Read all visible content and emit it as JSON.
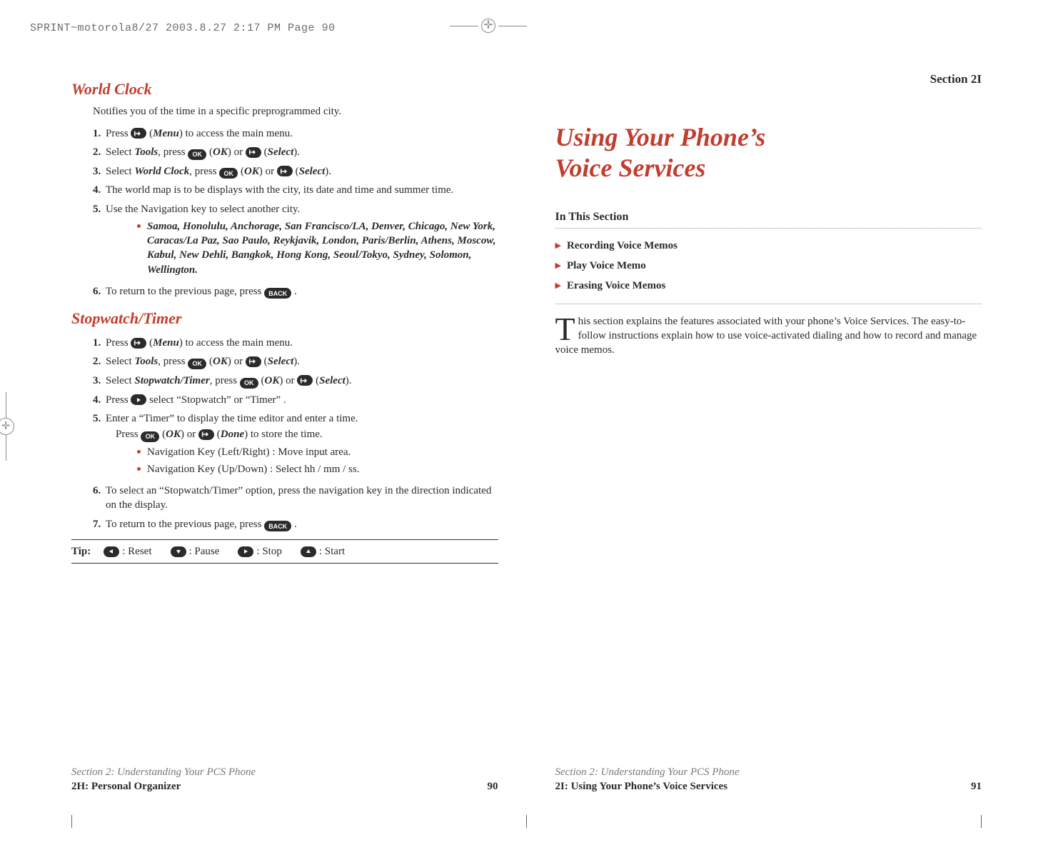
{
  "printHeader": "SPRINT~motorola8/27  2003.8.27  2:17 PM  Page 90",
  "left": {
    "worldClock": {
      "heading": "World Clock",
      "lead": "Notifies you of the time in a specific preprogrammed city.",
      "steps": [
        {
          "n": "1.",
          "pre": "Press ",
          "key1type": "menu",
          "post1": " (",
          "b1": "Menu",
          "post2": ") to access the main menu."
        },
        {
          "n": "2.",
          "pre": "Select ",
          "b0": "Tools",
          "mid": ", press ",
          "k1": "OK",
          "p1": " (",
          "b1": "OK",
          "p2": ") or  ",
          "k2type": "menu",
          "p3": " (",
          "b2": "Select",
          "p4": ")."
        },
        {
          "n": "3.",
          "pre": "Select ",
          "b0": "World Clock",
          "mid": ", press ",
          "k1": "OK",
          "p1": " (",
          "b1": "OK",
          "p2": ") or  ",
          "k2type": "menu",
          "p3": " (",
          "b2": "Select",
          "p4": ")."
        },
        {
          "n": "4.",
          "text": "The world map is to be displays with the city, its date and time and summer time."
        },
        {
          "n": "5.",
          "text": "Use the Navigation key to select another city.",
          "bullets": [
            "Samoa, Honolulu, Anchorage, San Francisco/LA, Denver, Chicago, New York, Caracas/La Paz, Sao Paulo, Reykjavik, London, Paris/Berlin, Athens, Moscow, Kabul, New Dehli, Bangkok, Hong Kong, Seoul/Tokyo, Sydney, Solomon, Wellington."
          ],
          "bulletsBold": true
        },
        {
          "n": "6.",
          "pre": "To return to the previous page, press ",
          "k1": "BACK",
          "post": " ."
        }
      ]
    },
    "stopwatch": {
      "heading": "Stopwatch/Timer",
      "steps": [
        {
          "n": "1.",
          "pre": "Press ",
          "key1type": "menu",
          "post1": " (",
          "b1": "Menu",
          "post2": ") to access the main menu."
        },
        {
          "n": "2.",
          "pre": "Select ",
          "b0": "Tools",
          "mid": ", press ",
          "k1": "OK",
          "p1": " (",
          "b1": "OK",
          "p2": ") or  ",
          "k2type": "menu",
          "p3": " (",
          "b2": "Select",
          "p4": ")."
        },
        {
          "n": "3.",
          "pre": "Select ",
          "b0": "Stopwatch/Timer",
          "mid": ", press ",
          "k1": "OK",
          "p1": " (",
          "b1": "OK",
          "p2": ") or  ",
          "k2type": "menu",
          "p3": " (",
          "b2": "Select",
          "p4": ")."
        },
        {
          "n": "4.",
          "pre": "Press ",
          "key1type": "right",
          "post": " select “Stopwatch” or “Timer” ."
        },
        {
          "n": "5.",
          "text": "Enter a “Timer” to display the time editor and enter a time.",
          "line2pre": "Press ",
          "l2k1": "OK",
          "l2p1": " (",
          "l2b1": "OK",
          "l2p2": ") or  ",
          "l2k2type": "menu",
          "l2p3": " (",
          "l2b2": "Done",
          "l2p4": ") to store the time.",
          "bullets": [
            "Navigation Key (Left/Right) : Move input area.",
            "Navigation Key (Up/Down) : Select hh / mm / ss."
          ]
        },
        {
          "n": "6.",
          "text": "To select an “Stopwatch/Timer” option, press the navigation key in the direction indicated on the display."
        },
        {
          "n": "7.",
          "pre": "To return to the previous page, press ",
          "k1": "BACK",
          "post": " ."
        }
      ]
    },
    "tip": {
      "label": "Tip:",
      "items": [
        {
          "dir": "left",
          "text": ": Reset"
        },
        {
          "dir": "down",
          "text": ": Pause"
        },
        {
          "dir": "right",
          "text": ": Stop"
        },
        {
          "dir": "up",
          "text": ": Start"
        }
      ]
    },
    "footerTop": "Section 2: Understanding Your PCS Phone",
    "footerBottom": "2H: Personal Organizer",
    "pageNo": "90"
  },
  "right": {
    "sectionLabel": "Section 2I",
    "title1": "Using Your Phone’s",
    "title2": "Voice Services",
    "inThis": "In This Section",
    "toc": [
      "Recording Voice Memos",
      "Play Voice Memo",
      "Erasing Voice Memos"
    ],
    "paraFirst": "T",
    "paraRest": "his section explains the features associated with your phone’s Voice Services. The easy-to-follow instructions explain how to use voice-activated dialing and how to record and manage voice memos.",
    "footerTop": "Section 2: Understanding Your PCS Phone",
    "footerBottom": "2I: Using Your Phone’s Voice Services",
    "pageNo": "91"
  }
}
